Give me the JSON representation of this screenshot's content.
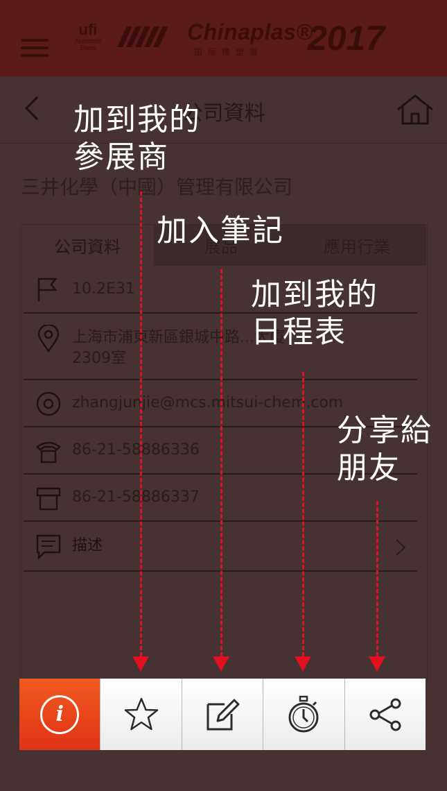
{
  "header": {
    "ufi_name": "ufi",
    "ufi_line1": "Approved",
    "ufi_line2": "Event",
    "brand": "Chinaplas®",
    "brand_sub": "国际橡塑展",
    "year": "2017"
  },
  "titlebar": {
    "title": "公司資料"
  },
  "company": {
    "name": "三井化學（中國）管理有限公司"
  },
  "tabs": [
    {
      "label": "公司資料",
      "active": true
    },
    {
      "label": "展品",
      "active": false
    },
    {
      "label": "應用行業",
      "active": false
    }
  ],
  "info_rows": [
    {
      "icon": "flag-icon",
      "text": "10.2E31"
    },
    {
      "icon": "location-pin-icon",
      "text": "上海市浦東新區銀城中路...大廈",
      "text2": "2309室"
    },
    {
      "icon": "at-sign-icon",
      "text": "zhangjunjie@mcs.mitsui-chem.com"
    },
    {
      "icon": "telephone-icon",
      "text": "86-21-58886336"
    },
    {
      "icon": "fax-icon",
      "text": "86-21-58886337"
    },
    {
      "icon": "chat-icon",
      "text": "描述"
    }
  ],
  "annotations": {
    "add_exhibitor": "加到我的\n參展商",
    "add_note": "加入筆記",
    "add_schedule": "加到我的\n日程表",
    "share": "分享給\n朋友"
  },
  "action_bar": {
    "buttons": [
      "info-icon",
      "star-icon",
      "edit-note-icon",
      "stopwatch-icon",
      "share-icon"
    ],
    "accent_color": "#e8401a"
  },
  "colors": {
    "overlay_bg": "#463233",
    "arrow": "#e01020",
    "annotation_text": "#ffffff"
  }
}
